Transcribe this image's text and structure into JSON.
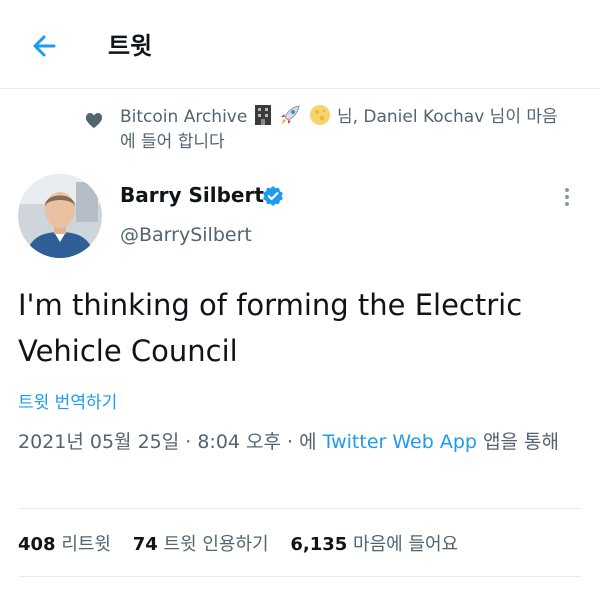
{
  "header": {
    "title": "트윗"
  },
  "liked": {
    "text_a": "Bitcoin Archive",
    "text_b": "님, Daniel Kochav 님이 마음에 들어 합니다"
  },
  "tweet": {
    "name": "Barry Silbert",
    "handle": "@BarrySilbert",
    "text": "I'm thinking of forming the Electric Vehicle Council",
    "translate": "트윗 번역하기",
    "date": "2021년 05월 25일 · 8:04 오후 · 에 ",
    "source": "Twitter Web App",
    "suffix": " 앱을 통해"
  },
  "stats": {
    "retweets_count": "408",
    "retweets_label": "리트윗",
    "quotes_count": "74",
    "quotes_label": "트윗 인용하기",
    "likes_count": "6,135",
    "likes_label": "마음에 들어요"
  },
  "colors": {
    "accent": "#1d9bf0",
    "muted": "#536471",
    "text": "#0f1419"
  },
  "icons": [
    "back-arrow-icon",
    "heart-icon",
    "building-emoji-icon",
    "rocket-emoji-icon",
    "moon-emoji-icon",
    "verified-badge-icon",
    "more-options-icon"
  ]
}
